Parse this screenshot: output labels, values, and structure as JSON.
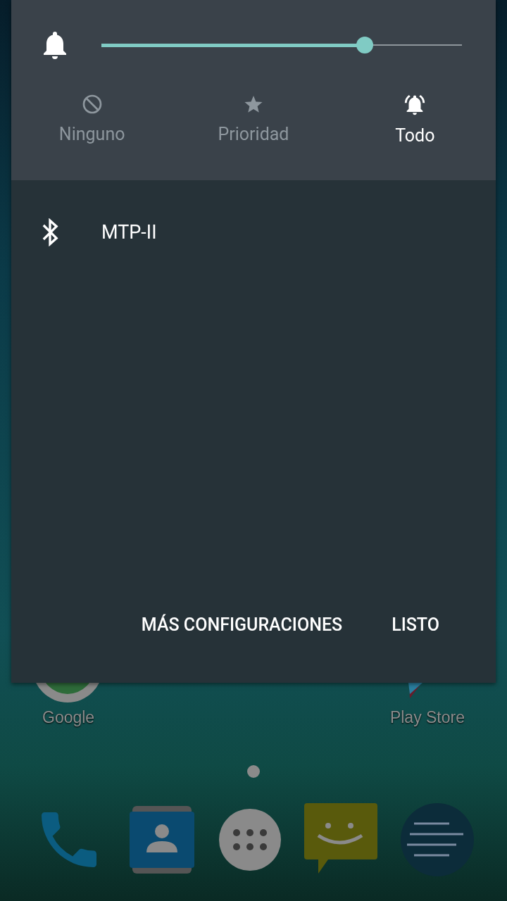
{
  "volume": {
    "level": 0.73
  },
  "modes": [
    {
      "label": "Ninguno",
      "kind": "none",
      "selected": false
    },
    {
      "label": "Prioridad",
      "kind": "priority",
      "selected": false
    },
    {
      "label": "Todo",
      "kind": "all",
      "selected": true
    }
  ],
  "devices": [
    {
      "name": "MTP-II"
    }
  ],
  "buttons": [
    "MÁS CONFIGURACIONES",
    "LISTO"
  ],
  "home_apps": [
    {
      "label": "Google"
    },
    {
      "label": "Play Store"
    }
  ]
}
